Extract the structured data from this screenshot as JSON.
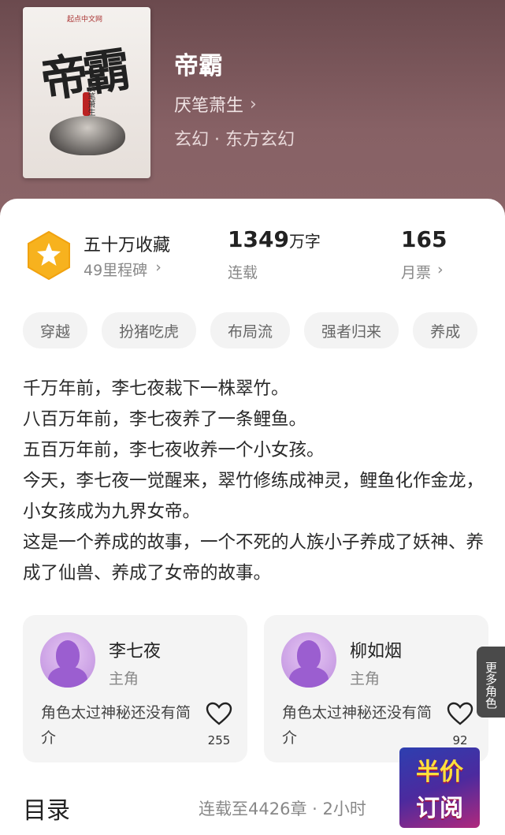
{
  "book": {
    "cover_publisher": "起点中文网",
    "cover_title": "帝霸",
    "cover_author": "厌笔萧生",
    "title": "帝霸",
    "author": "厌笔萧生",
    "genre": "玄幻 · 东方玄幻"
  },
  "stats": {
    "collection_label": "五十万收藏",
    "milestone_label": "49里程碑",
    "word_count_number": "1349",
    "word_count_unit": "万字",
    "status": "连载",
    "monthly_tickets": "165",
    "monthly_tickets_label": "月票"
  },
  "tags": [
    "穿越",
    "扮猪吃虎",
    "布局流",
    "强者归来",
    "养成"
  ],
  "synopsis": "千万年前，李七夜栽下一株翠竹。\n八百万年前，李七夜养了一条鲤鱼。\n五百万年前，李七夜收养一个小女孩。\n今天，李七夜一觉醒来，翠竹修练成神灵，鲤鱼化作金龙，小女孩成为九界女帝。\n这是一个养成的故事，一个不死的人族小子养成了妖神、养成了仙兽、养成了女帝的故事。",
  "characters": [
    {
      "name": "李七夜",
      "role": "主角",
      "desc": "角色太过神秘还没有简介",
      "likes": "255"
    },
    {
      "name": "柳如烟",
      "role": "主角",
      "desc": "角色太过神秘还没有简介",
      "likes": "92"
    }
  ],
  "more_roles_label": "更多角色",
  "toc": {
    "title": "目录",
    "info": "连载至4426章 · 2小时"
  },
  "promo": {
    "line1": "半价",
    "line2": "订阅"
  },
  "colors": {
    "hero_bg": "#876165",
    "badge": "#f7b21e",
    "avatar": "#9b5ed0"
  }
}
